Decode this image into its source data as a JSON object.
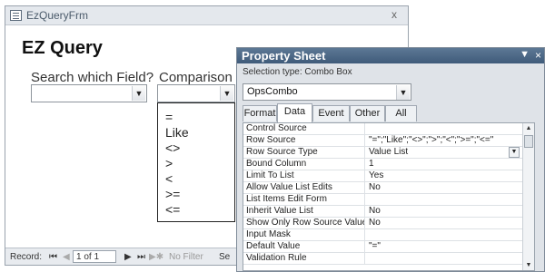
{
  "form": {
    "title": "EzQueryFrm",
    "close": "x",
    "heading": "EZ Query",
    "search_label": "Search which Field?",
    "comparison_label": "Comparison",
    "search_value": "",
    "comparison_value": "",
    "comparison_options": [
      "=",
      "Like",
      "<>",
      ">",
      "<",
      ">=",
      "<="
    ]
  },
  "recnav": {
    "label": "Record:",
    "first": "⏮",
    "prev": "◀",
    "position": "1 of 1",
    "next": "▶",
    "last": "⏭",
    "new": "▶✱",
    "filter": "No Filter",
    "search_stub": "Se"
  },
  "property_sheet": {
    "title": "Property Sheet",
    "pin": "▼",
    "close": "×",
    "selection_type": "Selection type:  Combo Box",
    "object": "OpsCombo",
    "tabs": [
      "Format",
      "Data",
      "Event",
      "Other",
      "All"
    ],
    "active_tab": "Data",
    "rows": [
      {
        "name": "Control Source",
        "value": ""
      },
      {
        "name": "Row Source",
        "value": "\"=\";\"Like\";\"<>\";\">\";\"<\";\">=\";\"<=\""
      },
      {
        "name": "Row Source Type",
        "value": "Value List"
      },
      {
        "name": "Bound Column",
        "value": "1"
      },
      {
        "name": "Limit To List",
        "value": "Yes"
      },
      {
        "name": "Allow Value List Edits",
        "value": "No"
      },
      {
        "name": "List Items Edit Form",
        "value": ""
      },
      {
        "name": "Inherit Value List",
        "value": "No"
      },
      {
        "name": "Show Only Row Source Values",
        "value": "No"
      },
      {
        "name": "Input Mask",
        "value": ""
      },
      {
        "name": "Default Value",
        "value": "\"=\""
      },
      {
        "name": "Validation Rule",
        "value": ""
      }
    ]
  }
}
